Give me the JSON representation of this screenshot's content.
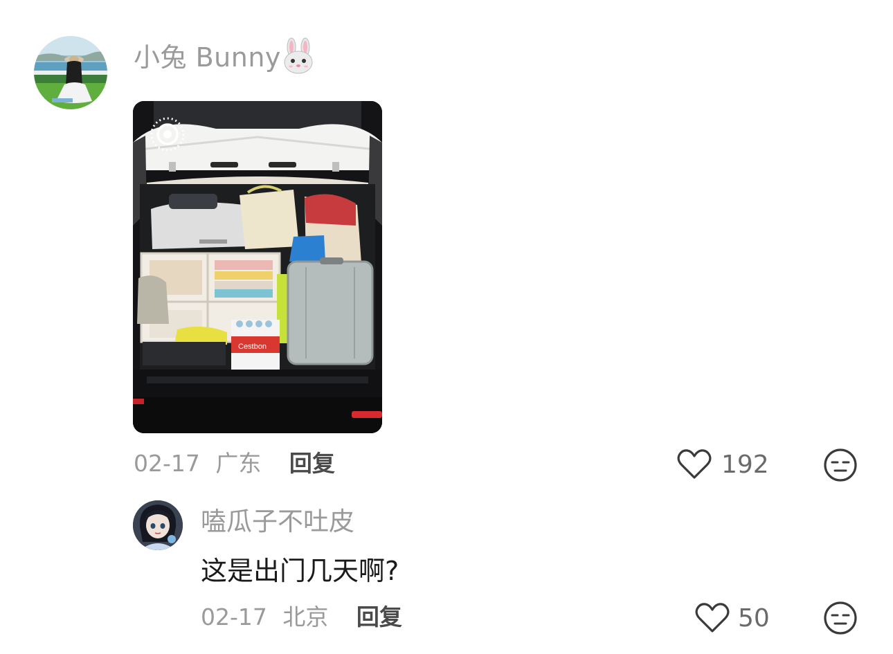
{
  "comment": {
    "username": "小兔 Bunny",
    "username_emoji": "rabbit-face-icon",
    "photo_badge": "live-photo-icon",
    "photo_label": "Cestbon",
    "date": "02-17",
    "location": "广东",
    "reply_label": "回复",
    "like_count": "192"
  },
  "reply": {
    "username": "嗑瓜子不吐皮",
    "text": "这是出门几天啊?",
    "date": "02-17",
    "location": "北京",
    "reply_label": "回复",
    "like_count": "50"
  },
  "colors": {
    "meta_gray": "#9a9a9a",
    "reply_dark": "#4a4a4a",
    "text_black": "#1a1a1a"
  }
}
